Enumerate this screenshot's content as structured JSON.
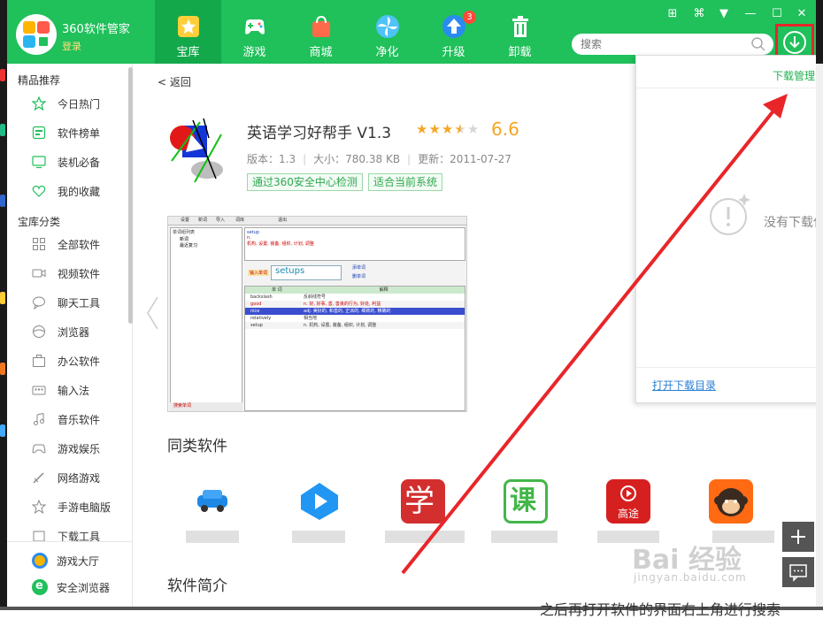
{
  "app": {
    "brand": "360软件管家",
    "login": "登录"
  },
  "nav": [
    {
      "label": "宝库",
      "active": true,
      "icon": "star-icon"
    },
    {
      "label": "游戏",
      "icon": "gamepad-icon"
    },
    {
      "label": "商城",
      "icon": "bag-icon"
    },
    {
      "label": "净化",
      "icon": "fan-icon"
    },
    {
      "label": "升级",
      "icon": "upgrade-icon",
      "badge": "3"
    },
    {
      "label": "卸载",
      "icon": "trash-icon"
    }
  ],
  "search": {
    "placeholder": "搜索"
  },
  "sidebar": {
    "group1": "精品推荐",
    "items1": [
      "今日热门",
      "软件榜单",
      "装机必备",
      "我的收藏"
    ],
    "group2": "宝库分类",
    "items2": [
      "全部软件",
      "视频软件",
      "聊天工具",
      "浏览器",
      "办公软件",
      "输入法",
      "音乐软件",
      "游戏娱乐",
      "网络游戏",
      "手游电脑版",
      "下载工具"
    ],
    "bottom": [
      "游戏大厅",
      "安全浏览器"
    ]
  },
  "detail": {
    "back": "< 返回",
    "name": "英语学习好帮手 V1.3",
    "rating": "6.6",
    "stars_filled": 3,
    "stars_half": 1,
    "stars_total": 5,
    "version": "版本：1.3",
    "size": "大小：780.38 KB",
    "updated": "更新：2011-07-27",
    "tag1": "通过360安全中心检测",
    "tag2": "适合当前系统",
    "similar_title": "同类软件",
    "intro_title": "软件简介"
  },
  "screenshot": {
    "menu": [
      "设置",
      "新词",
      "导入",
      "词库",
      "退出"
    ],
    "tree": [
      "单词组列表",
      "新词",
      "最近复习"
    ],
    "word_top": "setup",
    "word_top_def": "机构, 设置, 装备, 组织, 计划, 调整",
    "input_label": "输入单词",
    "input_value": "setups",
    "add_word": "添单词",
    "del_word": "删单词",
    "col1": "单 词",
    "col2": "解释",
    "rows": [
      [
        "backslash",
        "反斜线符号"
      ],
      [
        "good",
        "n. 好, 好事, 善, 善良的行为, 好处, 利益"
      ],
      [
        "nice",
        "adj. 美好的, 和善的, 正派的, 细致的, 精确的"
      ],
      [
        "relatively",
        "相当地"
      ],
      [
        "setup",
        "n. 机构, 设置, 装备, 组织, 计划, 调整"
      ]
    ],
    "bottom_label": "搜索单词"
  },
  "similar_apps": [
    {
      "icon": "car-app-icon",
      "color": "#ffffff"
    },
    {
      "icon": "play-app-icon",
      "color": "#ffffff"
    },
    {
      "icon": "xue-app-icon",
      "color": "#d32f2f",
      "glyph": "学"
    },
    {
      "icon": "ke-app-icon",
      "color": "#ffffff",
      "glyph": "课"
    },
    {
      "icon": "gaotu-app-icon",
      "color": "#d62020",
      "glyph": "高途"
    },
    {
      "icon": "monkey-app-icon",
      "color": "#ff6a13"
    }
  ],
  "download_panel": {
    "title": "下载管理",
    "empty": "没有下载任务",
    "open_dir": "打开下载目录"
  },
  "watermark": {
    "brand": "Bai 经验",
    "url": "jingyan.baidu.com"
  },
  "overlay_text": "之后再打开软件的界面右上角进行搜索",
  "colors": {
    "brand_green": "#20c05b",
    "active_green": "#13a84a",
    "accent_red": "#e8262a",
    "star_orange": "#f5a623"
  }
}
